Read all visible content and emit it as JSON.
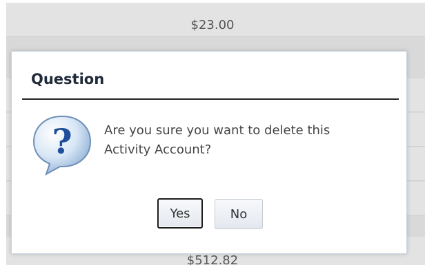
{
  "background": {
    "amount_top": "$23.00",
    "amount_bottom": "$512.82"
  },
  "dialog": {
    "title": "Question",
    "icon": "question-balloon-icon",
    "message_line1": "Are you sure you want to delete this",
    "message_line2": "Activity Account?",
    "buttons": {
      "yes": "Yes",
      "no": "No"
    }
  },
  "colors": {
    "icon_blue": "#2b6cb8",
    "title_rule": "#222222",
    "background_grid": "#d9d9d9"
  }
}
